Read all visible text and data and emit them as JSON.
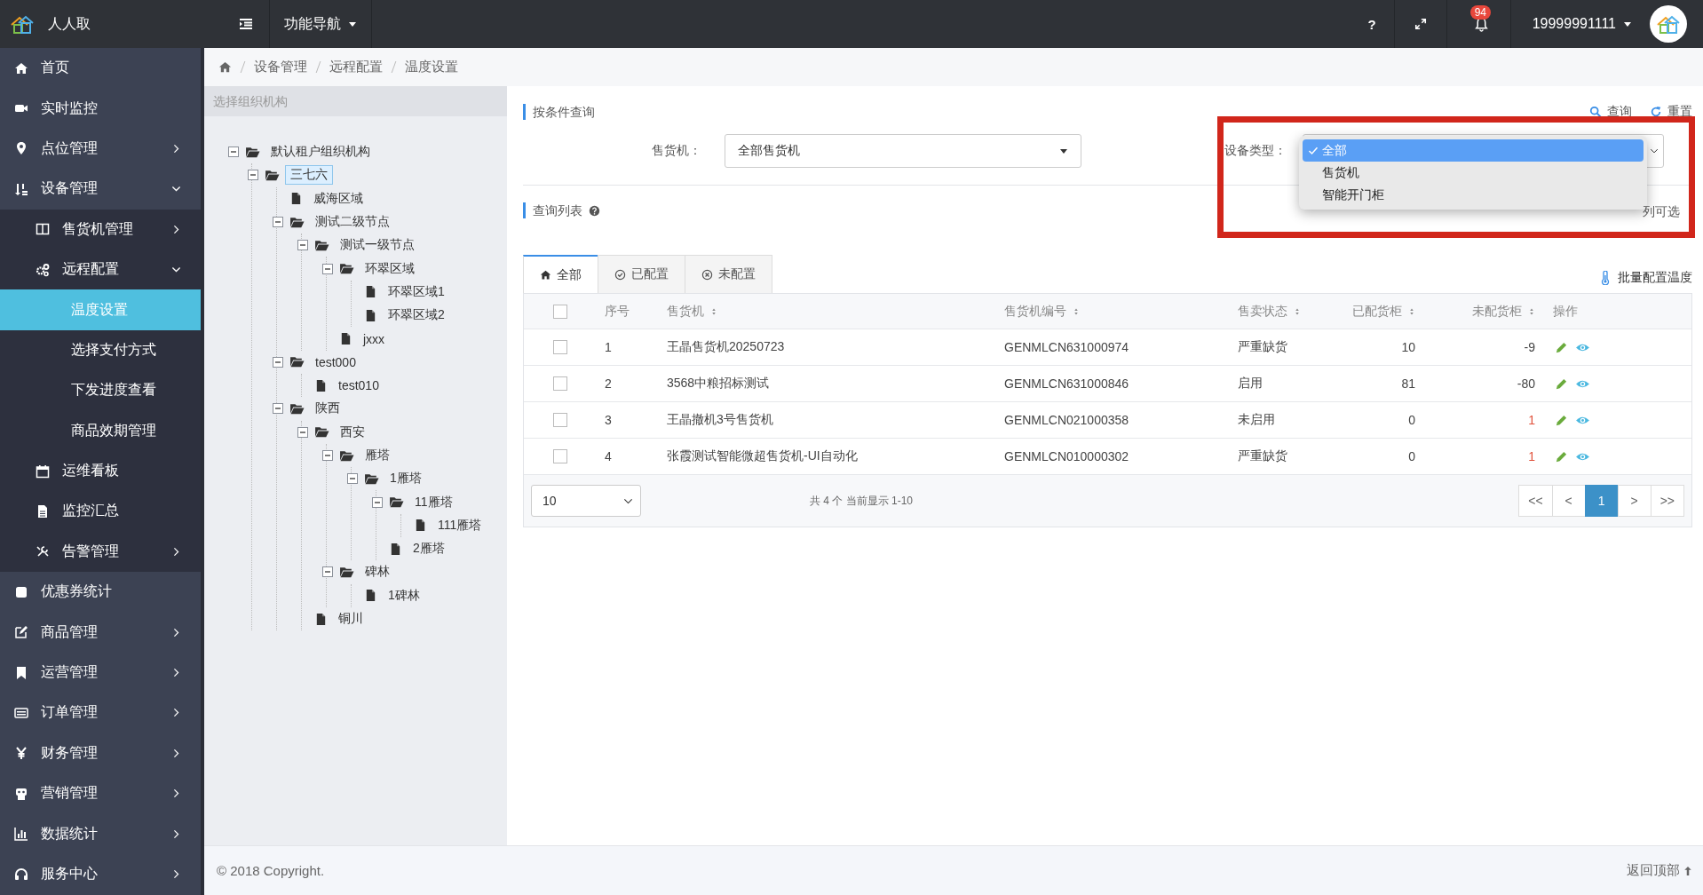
{
  "topbar": {
    "logo_text": "人人取",
    "nav_menu": "功能导航",
    "help": "?",
    "notification_count": "94",
    "user": "19999991111"
  },
  "sidebar": {
    "items": [
      {
        "label": "首页",
        "selected": false
      },
      {
        "label": "实时监控",
        "selected": false
      },
      {
        "label": "点位管理",
        "selected": false,
        "expanded": false
      },
      {
        "label": "设备管理",
        "selected": false,
        "expanded": true,
        "children": [
          {
            "label": "售货机管理",
            "selected": false,
            "expanded": false
          },
          {
            "label": "远程配置",
            "selected": false,
            "expanded": true,
            "children": [
              {
                "label": "温度设置",
                "selected": true
              },
              {
                "label": "选择支付方式",
                "selected": false
              },
              {
                "label": "下发进度查看",
                "selected": false
              },
              {
                "label": "商品效期管理",
                "selected": false
              }
            ]
          },
          {
            "label": "运维看板",
            "selected": false
          },
          {
            "label": "监控汇总",
            "selected": false
          },
          {
            "label": "告警管理",
            "selected": false,
            "expanded": false
          }
        ]
      },
      {
        "label": "优惠券统计",
        "selected": false
      },
      {
        "label": "商品管理",
        "selected": false,
        "expanded": false
      },
      {
        "label": "运营管理",
        "selected": false,
        "expanded": false
      },
      {
        "label": "订单管理",
        "selected": false,
        "expanded": false
      },
      {
        "label": "财务管理",
        "selected": false,
        "expanded": false
      },
      {
        "label": "营销管理",
        "selected": false,
        "expanded": false
      },
      {
        "label": "数据统计",
        "selected": false,
        "expanded": false
      },
      {
        "label": "服务中心",
        "selected": false,
        "expanded": false
      }
    ]
  },
  "breadcrumb": [
    "设备管理",
    "远程配置",
    "温度设置"
  ],
  "org_tree": {
    "title": "选择组织机构",
    "nodes": [
      {
        "label": "默认租户组织机构",
        "kind": "folder",
        "selected": false,
        "expanded": true,
        "children": [
          {
            "label": "三七六",
            "kind": "folder",
            "selected": true,
            "expanded": true,
            "children": [
              {
                "label": "威海区域",
                "kind": "file",
                "selected": false
              },
              {
                "label": "测试二级节点",
                "kind": "folder",
                "selected": false,
                "expanded": true,
                "children": [
                  {
                    "label": "测试一级节点",
                    "kind": "folder",
                    "selected": false,
                    "expanded": true,
                    "children": [
                      {
                        "label": "环翠区域",
                        "kind": "folder",
                        "selected": false,
                        "expanded": true,
                        "children": [
                          {
                            "label": "环翠区域1",
                            "kind": "file",
                            "selected": false
                          },
                          {
                            "label": "环翠区域2",
                            "kind": "file",
                            "selected": false
                          }
                        ]
                      },
                      {
                        "label": "jxxx",
                        "kind": "file",
                        "selected": false
                      }
                    ]
                  }
                ]
              },
              {
                "label": "test000",
                "kind": "folder",
                "selected": false,
                "expanded": true,
                "children": [
                  {
                    "label": "test010",
                    "kind": "file",
                    "selected": false
                  }
                ]
              },
              {
                "label": "陕西",
                "kind": "folder",
                "selected": false,
                "expanded": true,
                "children": [
                  {
                    "label": "西安",
                    "kind": "folder",
                    "selected": false,
                    "expanded": true,
                    "children": [
                      {
                        "label": "雁塔",
                        "kind": "folder",
                        "selected": false,
                        "expanded": true,
                        "children": [
                          {
                            "label": "1雁塔",
                            "kind": "folder",
                            "selected": false,
                            "expanded": true,
                            "children": [
                              {
                                "label": "11雁塔",
                                "kind": "folder",
                                "selected": false,
                                "expanded": true,
                                "children": [
                                  {
                                    "label": "111雁塔",
                                    "kind": "file",
                                    "selected": false
                                  }
                                ]
                              },
                              {
                                "label": "2雁塔",
                                "kind": "file",
                                "selected": false
                              }
                            ]
                          }
                        ]
                      },
                      {
                        "label": "碑林",
                        "kind": "folder",
                        "selected": false,
                        "expanded": true,
                        "children": [
                          {
                            "label": "1碑林",
                            "kind": "file",
                            "selected": false
                          }
                        ]
                      }
                    ]
                  },
                  {
                    "label": "铜川",
                    "kind": "file",
                    "selected": false
                  }
                ]
              }
            ]
          }
        ]
      }
    ]
  },
  "filter": {
    "title": "按条件查询",
    "query_button": "查询",
    "reset_button": "重置",
    "vending_machine": {
      "label": "售货机：",
      "value": "全部售货机"
    },
    "device_type": {
      "label": "设备类型：",
      "options": [
        {
          "label": "全部",
          "selected": true
        },
        {
          "label": "售货机",
          "selected": false
        },
        {
          "label": "智能开门柜",
          "selected": false
        }
      ]
    }
  },
  "list": {
    "title": "查询列表",
    "column_toggle": "列可选",
    "batch_button": "批量配置温度",
    "tabs": [
      {
        "label": "全部",
        "selected": true
      },
      {
        "label": "已配置",
        "selected": false
      },
      {
        "label": "未配置",
        "selected": false
      }
    ],
    "columns": [
      {
        "label": "序号",
        "sortable": false
      },
      {
        "label": "售货机",
        "sortable": true
      },
      {
        "label": "售货机编号",
        "sortable": true
      },
      {
        "label": "售卖状态",
        "sortable": true
      },
      {
        "label": "已配货柜",
        "sortable": true
      },
      {
        "label": "未配货柜",
        "sortable": true
      },
      {
        "label": "操作",
        "sortable": false
      }
    ],
    "header_checked": false,
    "rows": [
      {
        "checked": false,
        "index": "1",
        "name": "王晶售货机20250723",
        "code": "GENMLCN631000974",
        "status": "严重缺货",
        "assigned": "10",
        "unassigned": "-9",
        "warning": false
      },
      {
        "checked": false,
        "index": "2",
        "name": "3568中粮招标测试",
        "code": "GENMLCN631000846",
        "status": "启用",
        "assigned": "81",
        "unassigned": "-80",
        "warning": false
      },
      {
        "checked": false,
        "index": "3",
        "name": "王晶撤机3号售货机",
        "code": "GENMLCN021000358",
        "status": "未启用",
        "assigned": "0",
        "unassigned": "1",
        "warning": true
      },
      {
        "checked": false,
        "index": "4",
        "name": "张霞测试智能微超售货机-UI自动化",
        "code": "GENMLCN010000302",
        "status": "严重缺货",
        "assigned": "0",
        "unassigned": "1",
        "warning": true
      }
    ],
    "page_size": "10",
    "summary": "共 4 个 当前显示 1-10",
    "pager": [
      {
        "label": "<<",
        "selected": false
      },
      {
        "label": "<",
        "selected": false
      },
      {
        "label": "1",
        "selected": true
      },
      {
        "label": ">",
        "selected": false
      },
      {
        "label": ">>",
        "selected": false
      }
    ]
  },
  "footer": {
    "copyright": "© 2018 Copyright.",
    "back_to_top": "返回顶部"
  }
}
